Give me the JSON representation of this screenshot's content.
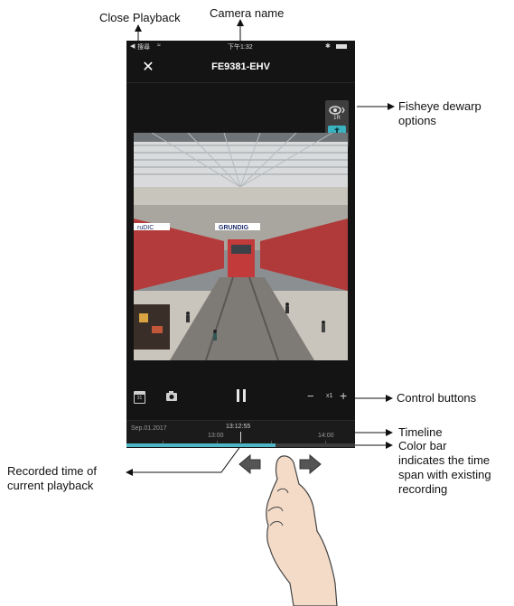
{
  "status_bar": {
    "carrier": "搜尋",
    "time": "下午1:32"
  },
  "header": {
    "close_icon": "close-icon",
    "camera_name": "FE9381-EHV"
  },
  "fisheye": {
    "view_icon": "eye-icon",
    "view_label": "1R",
    "move_icon": "move-arrows-icon",
    "accent_color": "#3bb2bf"
  },
  "video": {
    "signs": [
      "ruDIC",
      "GRUNDIG"
    ]
  },
  "controls": {
    "calendar_icon": "calendar-icon",
    "calendar_day": "31",
    "snapshot_icon": "camera-icon",
    "pause_icon": "pause-icon",
    "minus_label": "−",
    "speed": "x1",
    "plus_label": "+"
  },
  "timeline": {
    "date": "Sep.01.2017",
    "current_time": "13:12:55",
    "tick_1300": "13:00",
    "tick_1400": "14:00",
    "recording_color": "#4db6c4"
  },
  "callouts": {
    "close_playback": "Close Playback",
    "camera_name": "Camera name",
    "fisheye": [
      "Fisheye dewarp",
      "options"
    ],
    "control_buttons": "Control buttons",
    "timeline": "Timeline",
    "color_bar": [
      "Color bar",
      "indicates the time",
      "span with existing",
      "recording"
    ],
    "recorded_time": [
      "Recorded time of",
      "current playback"
    ]
  }
}
